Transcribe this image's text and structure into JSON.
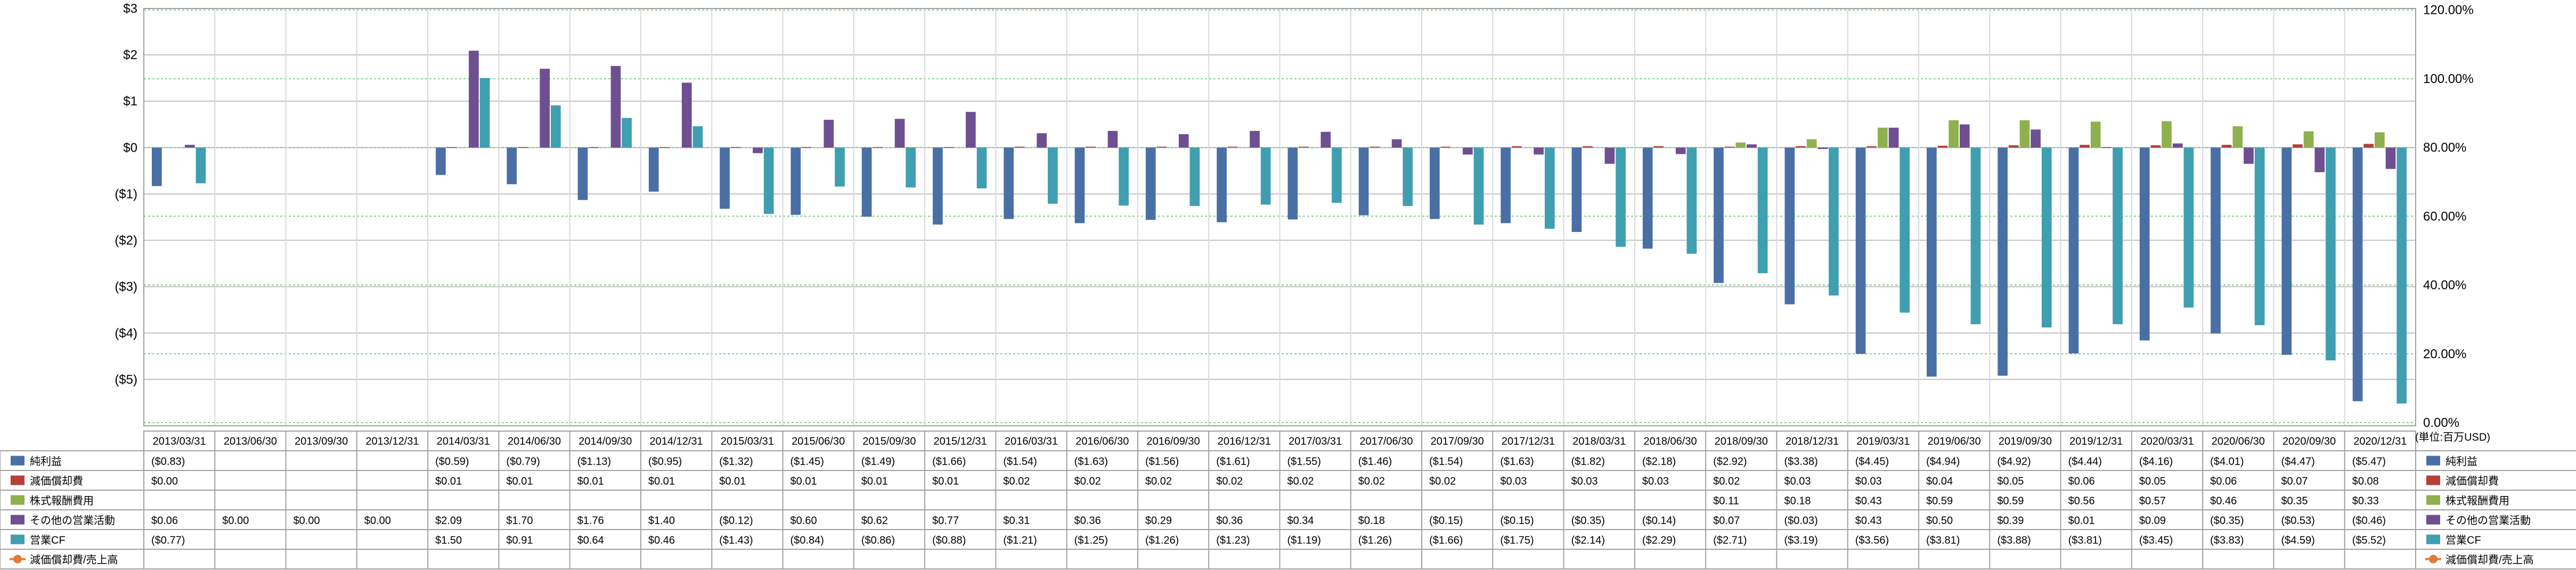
{
  "chart_data": {
    "type": "bar",
    "categories": [
      "2013/03/31",
      "2013/06/30",
      "2013/09/30",
      "2013/12/31",
      "2014/03/31",
      "2014/06/30",
      "2014/09/30",
      "2014/12/31",
      "2015/03/31",
      "2015/06/30",
      "2015/09/30",
      "2015/12/31",
      "2016/03/31",
      "2016/06/30",
      "2016/09/30",
      "2016/12/31",
      "2017/03/31",
      "2017/06/30",
      "2017/09/30",
      "2017/12/31",
      "2018/03/31",
      "2018/06/30",
      "2018/09/30",
      "2018/12/31",
      "2019/03/31",
      "2019/06/30",
      "2019/09/30",
      "2019/12/31",
      "2020/03/31",
      "2020/06/30",
      "2020/09/30",
      "2020/12/31"
    ],
    "series": [
      {
        "name": "純利益",
        "color": "#4a6fa5",
        "axis": "left",
        "values": [
          -0.83,
          null,
          null,
          null,
          -0.59,
          -0.79,
          -1.13,
          -0.95,
          -1.32,
          -1.45,
          -1.49,
          -1.66,
          -1.54,
          -1.63,
          -1.56,
          -1.61,
          -1.55,
          -1.46,
          -1.54,
          -1.63,
          -1.82,
          -2.18,
          -2.92,
          -3.38,
          -4.45,
          -4.94,
          -4.92,
          -4.44,
          -4.16,
          -4.01,
          -4.47,
          -5.47
        ],
        "labels": [
          "($0.83)",
          "",
          "",
          "",
          "($0.59)",
          "($0.79)",
          "($1.13)",
          "($0.95)",
          "($1.32)",
          "($1.45)",
          "($1.49)",
          "($1.66)",
          "($1.54)",
          "($1.63)",
          "($1.56)",
          "($1.61)",
          "($1.55)",
          "($1.46)",
          "($1.54)",
          "($1.63)",
          "($1.82)",
          "($2.18)",
          "($2.92)",
          "($3.38)",
          "($4.45)",
          "($4.94)",
          "($4.92)",
          "($4.44)",
          "($4.16)",
          "($4.01)",
          "($4.47)",
          "($5.47)"
        ]
      },
      {
        "name": "減価償却費",
        "color": "#b5403a",
        "axis": "left",
        "values": [
          0.0,
          null,
          null,
          null,
          0.01,
          0.01,
          0.01,
          0.01,
          0.01,
          0.01,
          0.01,
          0.01,
          0.02,
          0.02,
          0.02,
          0.02,
          0.02,
          0.02,
          0.02,
          0.03,
          0.03,
          0.03,
          0.02,
          0.03,
          0.03,
          0.04,
          0.05,
          0.06,
          0.05,
          0.06,
          0.07,
          0.08
        ],
        "labels": [
          "$0.00",
          "",
          "",
          "",
          "$0.01",
          "$0.01",
          "$0.01",
          "$0.01",
          "$0.01",
          "$0.01",
          "$0.01",
          "$0.01",
          "$0.02",
          "$0.02",
          "$0.02",
          "$0.02",
          "$0.02",
          "$0.02",
          "$0.02",
          "$0.03",
          "$0.03",
          "$0.03",
          "$0.02",
          "$0.03",
          "$0.03",
          "$0.04",
          "$0.05",
          "$0.06",
          "$0.05",
          "$0.06",
          "$0.07",
          "$0.08"
        ]
      },
      {
        "name": "株式報酬費用",
        "color": "#8fb04e",
        "axis": "left",
        "values": [
          null,
          null,
          null,
          null,
          null,
          null,
          null,
          null,
          null,
          null,
          null,
          null,
          null,
          null,
          null,
          null,
          null,
          null,
          null,
          null,
          null,
          null,
          0.11,
          0.18,
          0.43,
          0.59,
          0.59,
          0.56,
          0.57,
          0.46,
          0.35,
          0.33
        ],
        "labels": [
          "",
          "",
          "",
          "",
          "",
          "",
          "",
          "",
          "",
          "",
          "",
          "",
          "",
          "",
          "",
          "",
          "",
          "",
          "",
          "",
          "",
          "",
          "$0.11",
          "$0.18",
          "$0.43",
          "$0.59",
          "$0.59",
          "$0.56",
          "$0.57",
          "$0.46",
          "$0.35",
          "$0.33"
        ]
      },
      {
        "name": "その他の営業活動",
        "color": "#6e4f91",
        "axis": "left",
        "values": [
          0.06,
          0.0,
          0.0,
          0.0,
          2.09,
          1.7,
          1.76,
          1.4,
          -0.12,
          0.6,
          0.62,
          0.77,
          0.31,
          0.36,
          0.29,
          0.36,
          0.34,
          0.18,
          -0.15,
          -0.15,
          -0.35,
          -0.14,
          0.07,
          -0.03,
          0.43,
          0.5,
          0.39,
          0.01,
          0.09,
          -0.35,
          -0.53,
          -0.46
        ],
        "labels": [
          "$0.06",
          "$0.00",
          "$0.00",
          "$0.00",
          "$2.09",
          "$1.70",
          "$1.76",
          "$1.40",
          "($0.12)",
          "$0.60",
          "$0.62",
          "$0.77",
          "$0.31",
          "$0.36",
          "$0.29",
          "$0.36",
          "$0.34",
          "$0.18",
          "($0.15)",
          "($0.15)",
          "($0.35)",
          "($0.14)",
          "$0.07",
          "($0.03)",
          "$0.43",
          "$0.50",
          "$0.39",
          "$0.01",
          "$0.09",
          "($0.35)",
          "($0.53)",
          "($0.46)"
        ]
      },
      {
        "name": "営業CF",
        "color": "#3f9fb0",
        "axis": "left",
        "values": [
          -0.77,
          null,
          null,
          null,
          1.5,
          0.91,
          0.64,
          0.46,
          -1.43,
          -0.84,
          -0.86,
          -0.88,
          -1.21,
          -1.25,
          -1.26,
          -1.23,
          -1.19,
          -1.26,
          -1.66,
          -1.75,
          -2.14,
          -2.29,
          -2.71,
          -3.19,
          -3.56,
          -3.81,
          -3.88,
          -3.81,
          -3.45,
          -3.83,
          -4.59,
          -5.52
        ],
        "labels": [
          "($0.77)",
          "",
          "",
          "",
          "$1.50",
          "$0.91",
          "$0.64",
          "$0.46",
          "($1.43)",
          "($0.84)",
          "($0.86)",
          "($0.88)",
          "($1.21)",
          "($1.25)",
          "($1.26)",
          "($1.23)",
          "($1.19)",
          "($1.26)",
          "($1.66)",
          "($1.75)",
          "($2.14)",
          "($2.29)",
          "($2.71)",
          "($3.19)",
          "($3.56)",
          "($3.81)",
          "($3.88)",
          "($3.81)",
          "($3.45)",
          "($3.83)",
          "($4.59)",
          "($5.52)"
        ]
      },
      {
        "name": "減価償却費/売上高",
        "color": "#e07b39",
        "axis": "right",
        "type": "line",
        "values": [
          null,
          null,
          null,
          null,
          null,
          null,
          null,
          null,
          null,
          null,
          null,
          null,
          null,
          null,
          null,
          null,
          null,
          null,
          null,
          null,
          null,
          null,
          null,
          null,
          null,
          null,
          null,
          null,
          null,
          null,
          null,
          null
        ],
        "labels": [
          "",
          "",
          "",
          "",
          "",
          "",
          "",
          "",
          "",
          "",
          "",
          "",
          "",
          "",
          "",
          "",
          "",
          "",
          "",
          "",
          "",
          "",
          "",
          "",
          "",
          "",
          "",
          "",
          "",
          "",
          "",
          ""
        ]
      }
    ],
    "yleft": {
      "ticks": [
        "$3",
        "$2",
        "$1",
        "$0",
        "($1)",
        "($2)",
        "($3)",
        "($4)",
        "($5)"
      ],
      "values": [
        3,
        2,
        1,
        0,
        -1,
        -2,
        -3,
        -4,
        -5
      ],
      "range": [
        -6,
        3
      ]
    },
    "yright": {
      "ticks": [
        "120.00%",
        "100.00%",
        "80.00%",
        "60.00%",
        "40.00%",
        "20.00%",
        "0.00%"
      ],
      "range": [
        0,
        120
      ]
    },
    "unit_note": "(単位:百万USD)",
    "colors": {
      "negative_tick": "#cc0000",
      "grid": "#c0c0c0",
      "pct_grid": "#7fd07f"
    }
  }
}
